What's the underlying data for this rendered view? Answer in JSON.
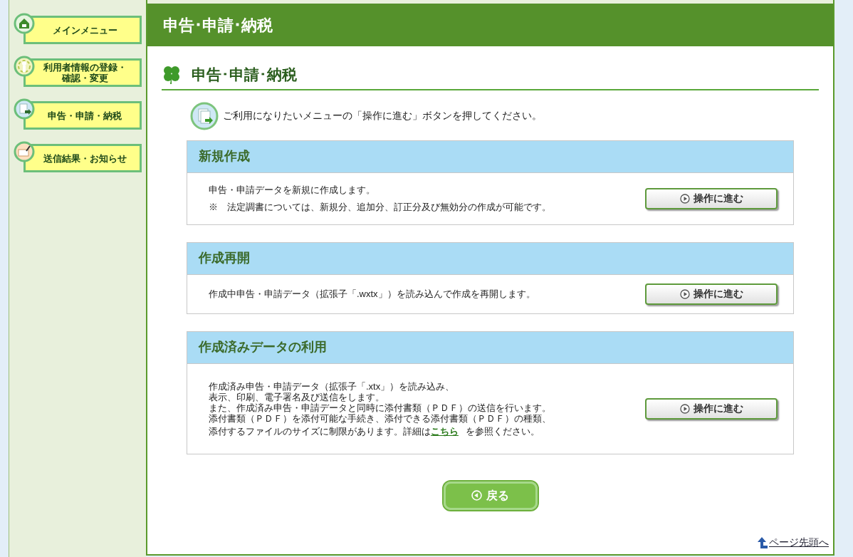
{
  "sidebar": {
    "items": [
      {
        "label": "メインメニュー"
      },
      {
        "label": "利用者情報の登録・確認・変更"
      },
      {
        "label": "申告・申請・納税"
      },
      {
        "label": "送信結果・お知らせ"
      }
    ]
  },
  "header": {
    "title": "申告･申請･納税"
  },
  "page_title": "申告･申請･納税",
  "instruction": "ご利用になりたいメニューの「操作に進む」ボタンを押してください。",
  "sections": [
    {
      "title": "新規作成",
      "lines": [
        {
          "kind": "text",
          "text": "申告・申請データを新規に作成します。"
        },
        {
          "kind": "text",
          "text": "※　法定調書については、新規分、追加分、訂正分及び無効分の作成が可能です。"
        }
      ],
      "button": "操作に進む"
    },
    {
      "title": "作成再開",
      "lines": [
        {
          "kind": "text",
          "text": "作成中申告・申請データ（拡張子「.wxtx」）を読み込んで作成を再開します。"
        }
      ],
      "button": "操作に進む"
    },
    {
      "title": "作成済みデータの利用",
      "lines": [
        {
          "kind": "text",
          "text": "作成済み申告・申請データ（拡張子「.xtx」）を読み込み、"
        },
        {
          "kind": "text",
          "text": "表示、印刷、電子署名及び送信をします。"
        },
        {
          "kind": "text",
          "text": "また、作成済み申告・申請データと同時に添付書類（ＰＤＦ）の送信を行います。"
        },
        {
          "kind": "text",
          "text": "添付書類（ＰＤＦ）を添付可能な手続き、添付できる添付書類（ＰＤＦ）の種類、"
        },
        {
          "kind": "link_line",
          "before": "添付するファイルのサイズに制限があります。詳細は",
          "link": "こちら",
          "after": "を参照ください。"
        }
      ],
      "button": "操作に進む"
    }
  ],
  "back_button": "戻る",
  "page_top_link": "ページ先頭へ"
}
